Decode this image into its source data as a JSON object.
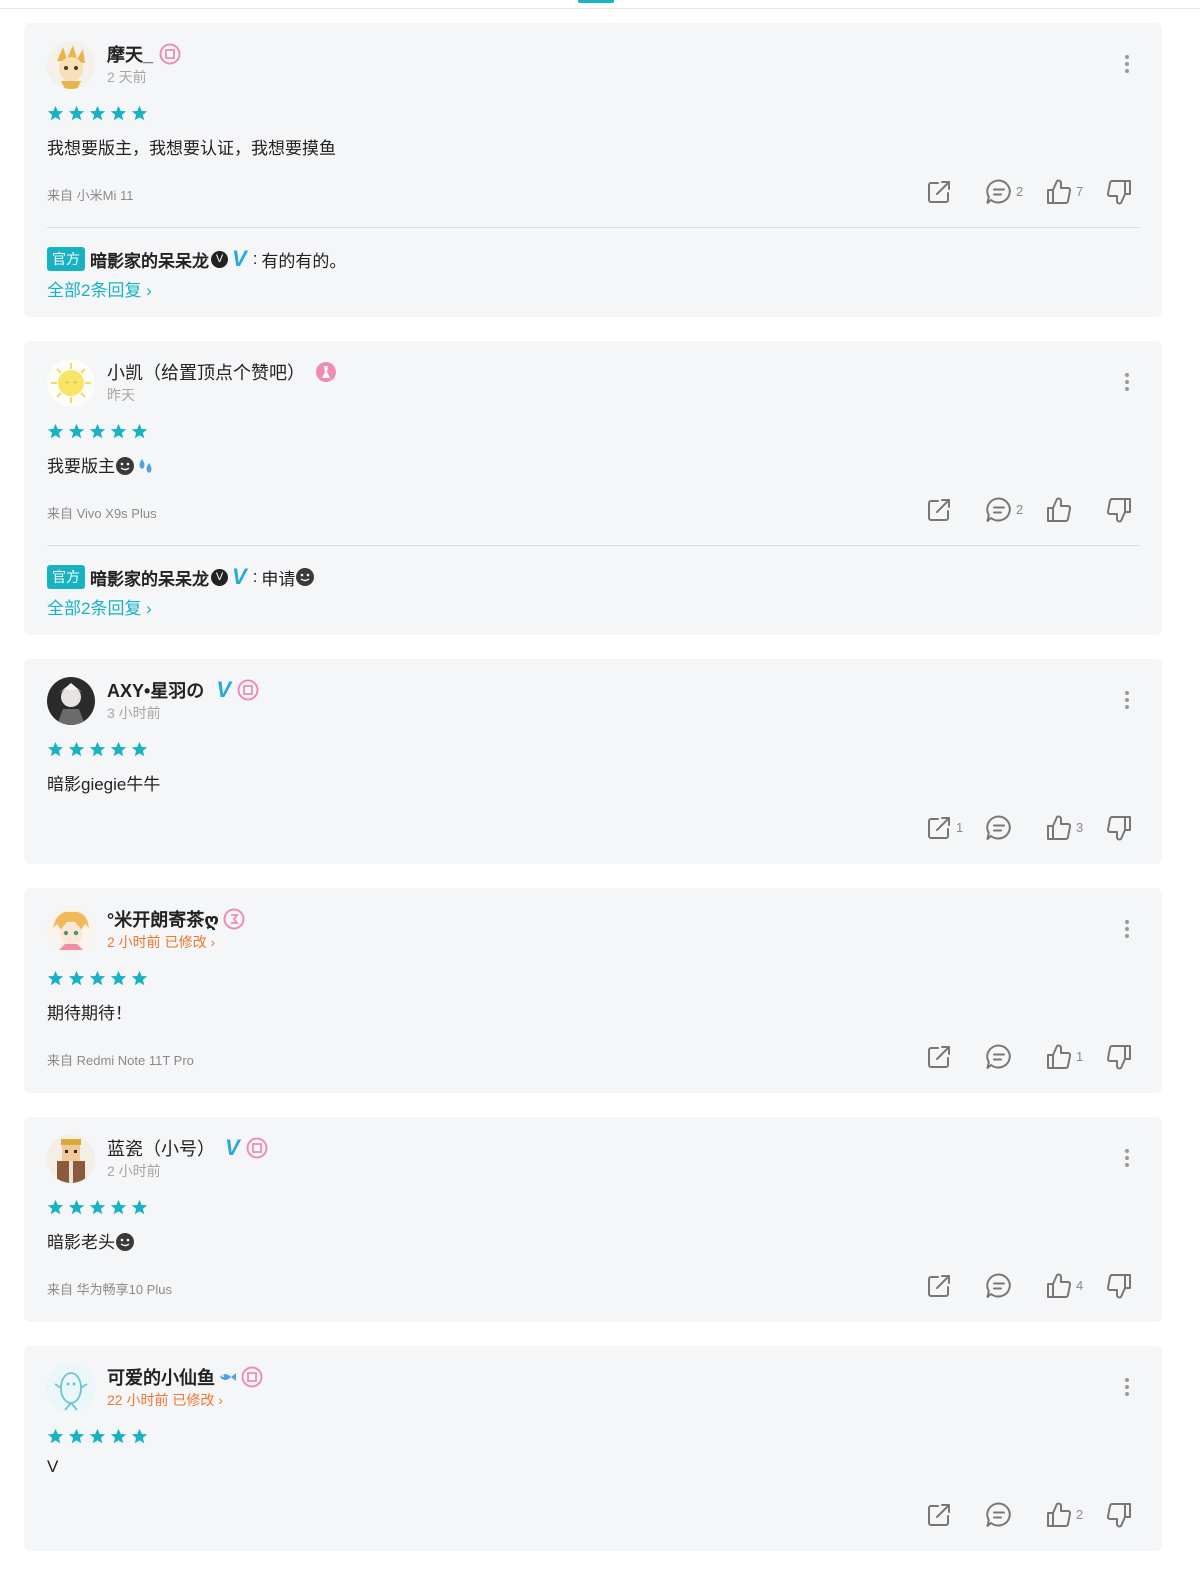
{
  "colors": {
    "accent": "#17b3c2",
    "verified": "#29a8dc",
    "edited": "#f0762e",
    "star": "#17b3c2",
    "level_badge": "#f08cb1"
  },
  "reviews": [
    {
      "username": "摩天_",
      "time": "2 天前",
      "verified": false,
      "rating": 5,
      "content": "我想要版主，我想要认证，我想要摸鱼",
      "device": "来自 小米Mi 11",
      "share_count": "",
      "comment_count": "2",
      "like_count": "7",
      "reply": {
        "tag": "官方",
        "author": "暗影家的呆呆龙",
        "colon": ":",
        "text": "有的有的。"
      },
      "view_all": "全部2条回复 ›"
    },
    {
      "username": "小凯（给置顶点个赞吧）",
      "time": "昨天",
      "verified": false,
      "rating": 5,
      "content": "我要版主",
      "device": "来自 Vivo X9s Plus",
      "share_count": "",
      "comment_count": "2",
      "like_count": "",
      "reply": {
        "tag": "官方",
        "author": "暗影家的呆呆龙",
        "colon": ":",
        "text": "申请"
      },
      "view_all": "全部2条回复 ›"
    },
    {
      "username": "AXY•星羽の",
      "time": "3 小时前",
      "verified": true,
      "rating": 5,
      "content": "暗影giegie牛牛",
      "device": "",
      "share_count": "1",
      "comment_count": "",
      "like_count": "3"
    },
    {
      "username": "°米开朗寄茶ღ",
      "time": "2 小时前 已修改 ›",
      "verified": false,
      "rating": 5,
      "content": "期待期待！",
      "device": "来自 Redmi Note 11T Pro",
      "share_count": "",
      "comment_count": "",
      "like_count": "1"
    },
    {
      "username": "蓝瓷（小号）",
      "time": "2 小时前",
      "verified": true,
      "rating": 5,
      "content": "暗影老头",
      "device": "来自 华为畅享10 Plus",
      "share_count": "",
      "comment_count": "",
      "like_count": "4"
    },
    {
      "username": "可爱的小仙鱼",
      "time": "22 小时前 已修改 ›",
      "verified": false,
      "rating": 5,
      "content": "V",
      "device": "",
      "share_count": "",
      "comment_count": "",
      "like_count": "2"
    }
  ],
  "icons": {
    "more": "more-vertical-icon",
    "share": "share-icon",
    "comment": "comment-icon",
    "like": "thumbs-up-icon",
    "dislike": "thumbs-down-icon",
    "star": "star-icon",
    "level": "level-badge-icon"
  }
}
